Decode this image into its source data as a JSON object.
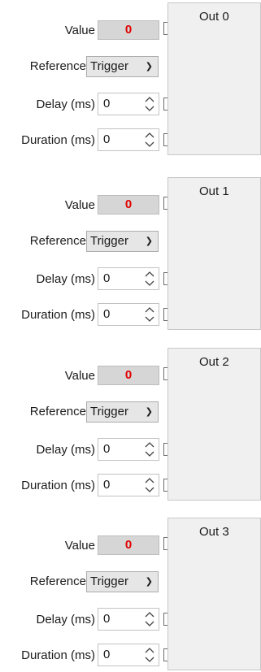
{
  "labels": {
    "value": "Value",
    "reference": "Reference",
    "delay": "Delay (ms)",
    "duration": "Duration (ms)"
  },
  "outputs": [
    {
      "title": "Out 0",
      "value": "0",
      "reference": "Trigger",
      "delay": "0",
      "duration": "0"
    },
    {
      "title": "Out 1",
      "value": "0",
      "reference": "Trigger",
      "delay": "0",
      "duration": "0"
    },
    {
      "title": "Out 2",
      "value": "0",
      "reference": "Trigger",
      "delay": "0",
      "duration": "0"
    },
    {
      "title": "Out 3",
      "value": "0",
      "reference": "Trigger",
      "delay": "0",
      "duration": "0"
    }
  ],
  "colors": {
    "value_text": "#e00000",
    "panel_bg": "#f0f0f0"
  }
}
